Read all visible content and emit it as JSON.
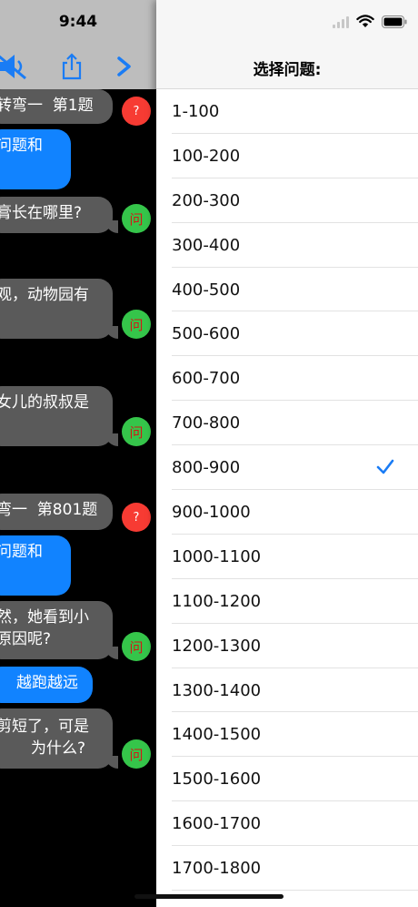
{
  "status_bar": {
    "time": "9:44"
  },
  "left_header": {
    "icons": [
      "mute-icon",
      "share-icon",
      "forward-icon"
    ]
  },
  "chat": {
    "b1": "转弯一  第1题",
    "b2": "问题和",
    "b3": "膏长在哪里?",
    "b4": "观，动物园有",
    "b5": "女儿的叔叔是",
    "b6": "弯一  第801题",
    "b7": "问题和",
    "b8a": "然，她看到小",
    "b8b": "原因呢?",
    "b9": "越跑越远",
    "b10a": "剪短了，可是",
    "b10b": "为什么?"
  },
  "badges": {
    "question": "?",
    "ask": "问"
  },
  "panel": {
    "title": "选择问题:",
    "selected": "800-900",
    "check_color": "#1a7cf5",
    "options": [
      "1-100",
      "100-200",
      "200-300",
      "300-400",
      "400-500",
      "500-600",
      "600-700",
      "700-800",
      "800-900",
      "900-1000",
      "1000-1100",
      "1100-1200",
      "1200-1300",
      "1300-1400",
      "1400-1500",
      "1500-1600",
      "1600-1700",
      "1700-1800"
    ]
  }
}
